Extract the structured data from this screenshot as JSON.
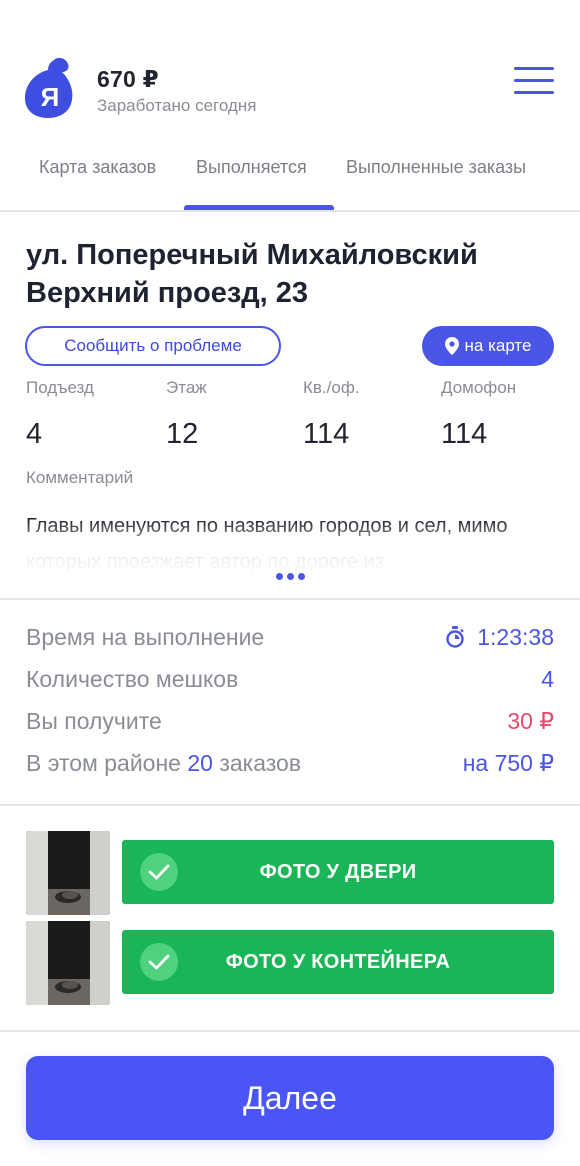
{
  "header": {
    "earned_amount": "670 ₽",
    "earned_label": "Заработано сегодня"
  },
  "tabs": [
    {
      "label": "Карта заказов",
      "active": false
    },
    {
      "label": "Выполняется",
      "active": true
    },
    {
      "label": "Выполненные заказы",
      "active": false
    }
  ],
  "order": {
    "address": "ул. Поперечный Михайловский Верхний проезд, 23",
    "report_button": "Сообщить о проблеме",
    "map_button": "на карте",
    "fields": [
      {
        "label": "Подъезд",
        "value": "4"
      },
      {
        "label": "Этаж",
        "value": "12"
      },
      {
        "label": "Кв./оф.",
        "value": "114"
      },
      {
        "label": "Домофон",
        "value": "114"
      }
    ],
    "comment_label": "Комментарий",
    "comment_text": "Главы именуются по названию городов и сел, мимо которых проезжает автор по дороге из"
  },
  "summary": {
    "time_label": "Время на выполнение",
    "time_value": "1:23:38",
    "bags_label": "Количество мешков",
    "bags_value": "4",
    "earn_label": "Вы получите",
    "earn_value": "30 ₽",
    "area_label_prefix": "В этом районе",
    "area_count": "20",
    "area_label_suffix": "заказов",
    "area_value": "на 750 ₽"
  },
  "photos": {
    "door_button": "ФОТО У ДВЕРИ",
    "container_button": "ФОТО У КОНТЕЙНЕРА"
  },
  "next_button": "Далее",
  "colors": {
    "accent": "#4a55e6",
    "success": "#19b556",
    "earn_red": "#e54b6c",
    "muted": "#8a8d96"
  }
}
